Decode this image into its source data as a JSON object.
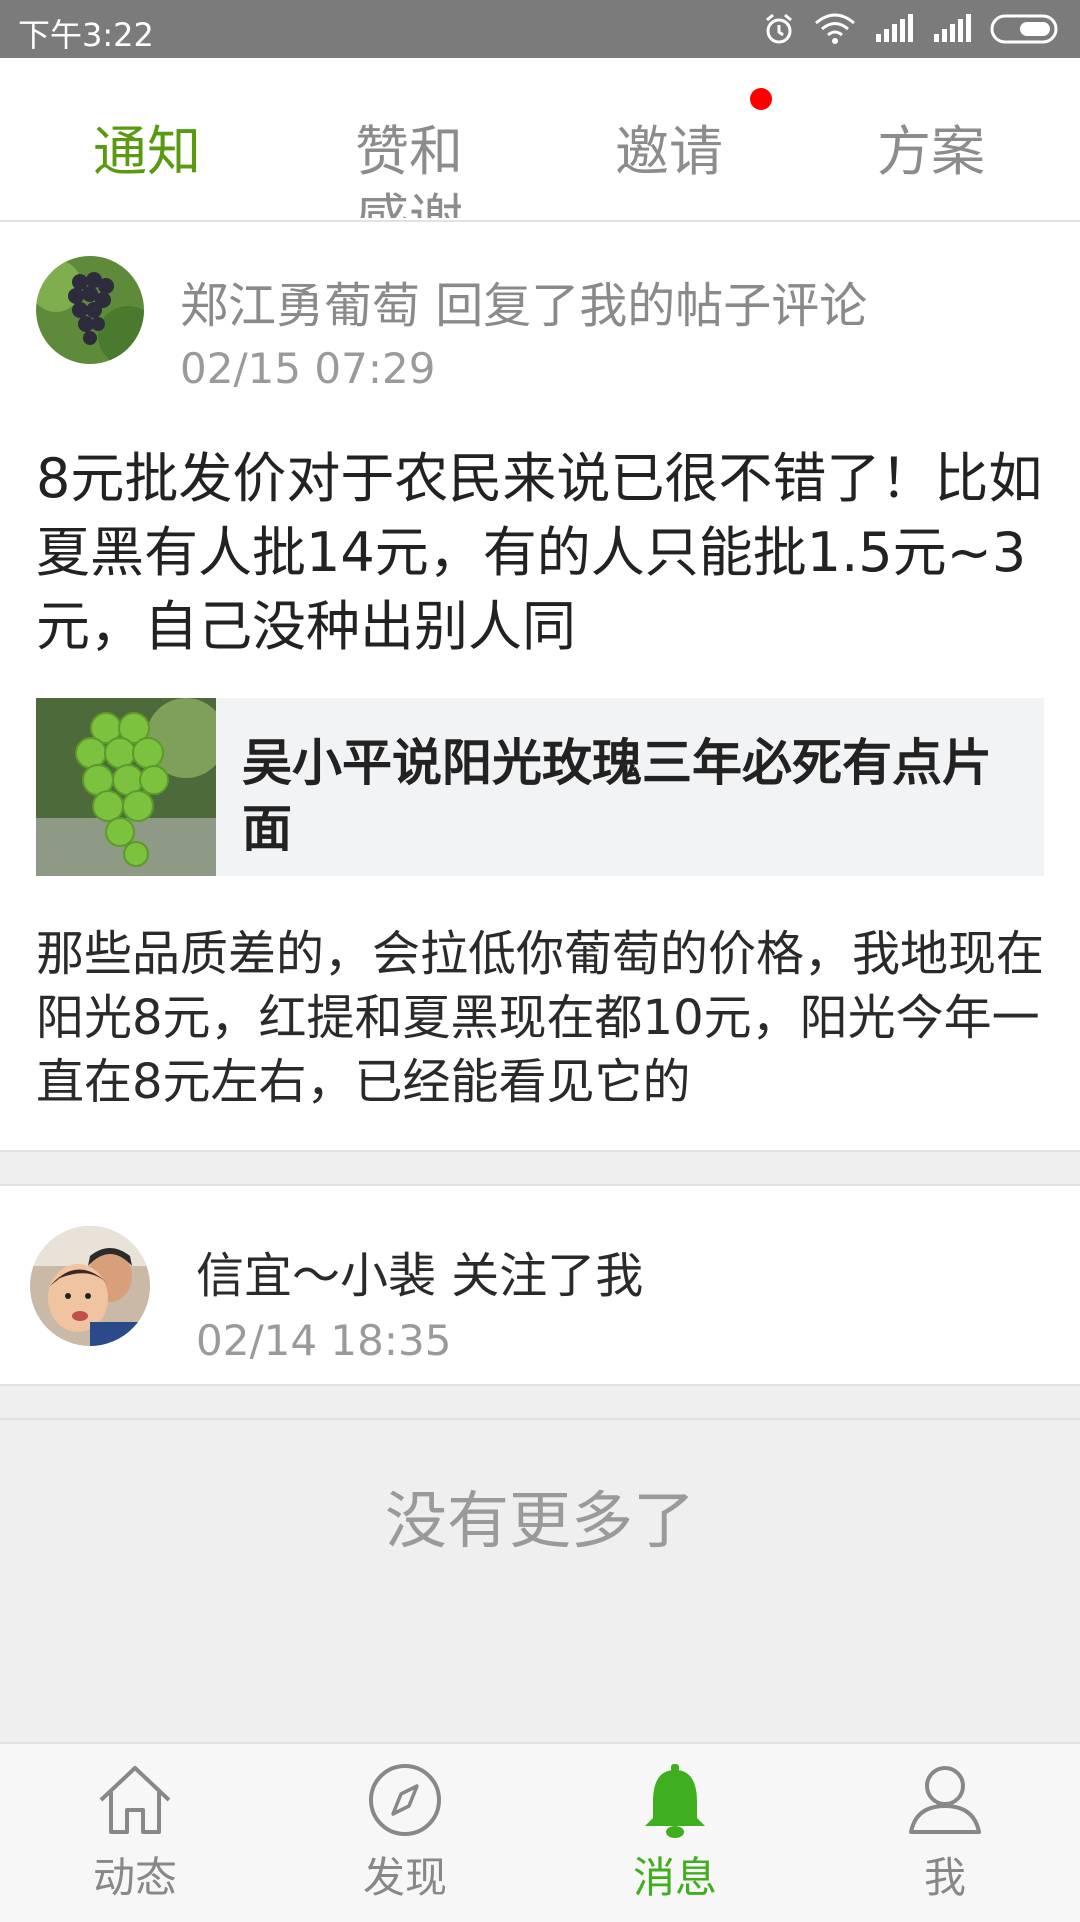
{
  "status_bar": {
    "time": "下午3:22",
    "icons": [
      "alarm-icon",
      "wifi-icon",
      "signal-icon",
      "signal-icon",
      "battery-icon"
    ]
  },
  "tabs": [
    {
      "label": "通知",
      "active": true
    },
    {
      "label": "赞和感谢",
      "active": false
    },
    {
      "label": "邀请",
      "active": false,
      "badge_dot": true
    },
    {
      "label": "方案",
      "active": false
    }
  ],
  "notifications": [
    {
      "header": "郑江勇葡萄 回复了我的帖子评论",
      "time": "02/15 07:29",
      "reply_text": "8元批发价对于农民来说已很不错了！比如夏黑有人批14元，有的人只能批1.5元~3元，自己没种出别人同",
      "quoted_post_title": "吴小平说阳光玫瑰三年必死有点片面",
      "original_comment": "那些品质差的，会拉低你葡萄的价格，我地现在阳光8元，红提和夏黑现在都10元，阳光今年一直在8元左右，已经能看见它的"
    },
    {
      "header": "信宜～小裴 关注了我",
      "time": "02/14 18:35"
    }
  ],
  "end_message": "没有更多了",
  "bottom_nav": [
    {
      "label": "动态",
      "icon": "home-icon",
      "active": false
    },
    {
      "label": "发现",
      "icon": "compass-icon",
      "active": false
    },
    {
      "label": "消息",
      "icon": "bell-icon",
      "active": true
    },
    {
      "label": "我",
      "icon": "person-icon",
      "active": false
    }
  ],
  "colors": {
    "accent_tab": "#5a9a12",
    "accent_nav": "#3fae1f",
    "badge": "#ff0000",
    "status_bar": "#7b7b7b"
  }
}
